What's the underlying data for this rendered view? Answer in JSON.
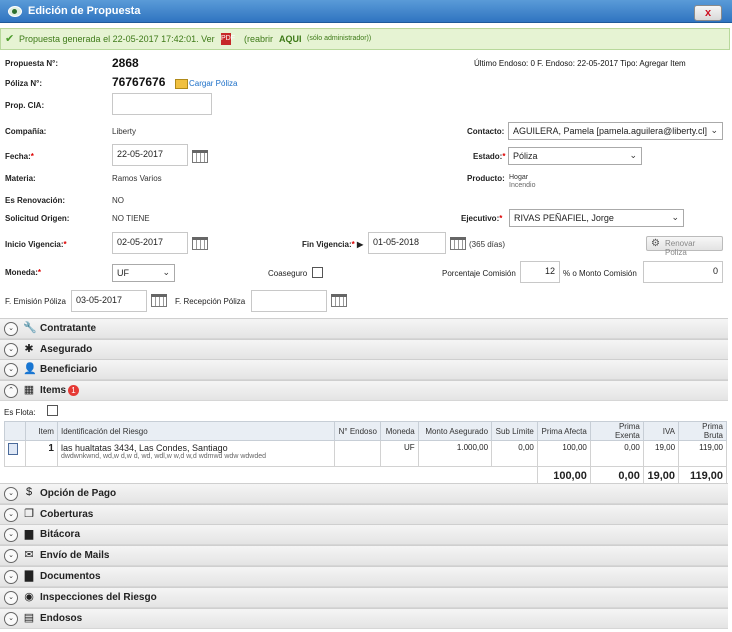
{
  "window": {
    "title": "Edición de Propuesta",
    "close_label": "x"
  },
  "notice": {
    "text": "Propuesta generada el 22-05-2017 17:42:01. Ver",
    "reopen_prefix": "(reabrir",
    "reopen_link": "AQUI",
    "admin_note": "(sólo administrador))"
  },
  "header": {
    "propuesta_label": "Propuesta N°:",
    "propuesta_value": "2868",
    "poliza_label": "Póliza N°:",
    "poliza_value": "76767676",
    "cargar_poliza": "Cargar Póliza",
    "ultimo_endoso": "Último Endoso: 0  F. Endoso: 22-05-2017  Tipo: Agregar Item"
  },
  "form": {
    "prop_cia_label": "Prop. CIA:",
    "prop_cia_value": "",
    "compania_label": "Compañía:",
    "compania_value": "Liberty",
    "contacto_label": "Contacto:",
    "contacto_value": "AGUILERA, Pamela [pamela.aguilera@liberty.cl]",
    "fecha_label": "Fecha:",
    "fecha_value": "22-05-2017",
    "estado_label": "Estado:",
    "estado_value": "Póliza",
    "materia_label": "Materia:",
    "materia_value": "Ramos Varios",
    "producto_label": "Producto:",
    "producto_value": "Hogar",
    "producto_sub": "Incendio",
    "renovacion_label": "Es Renovación:",
    "renovacion_value": "NO",
    "solicitud_label": "Solicitud Origen:",
    "solicitud_value": "NO TIENE",
    "ejecutivo_label": "Ejecutivo:",
    "ejecutivo_value": "RIVAS PEÑAFIEL, Jorge",
    "inicio_label": "Inicio Vigencia:",
    "inicio_value": "02-05-2017",
    "fin_label": "Fin Vigencia:",
    "fin_value": "01-05-2018",
    "dias": "(365 días)",
    "renovar_button": "Renovar Poliza",
    "moneda_label": "Moneda:",
    "moneda_value": "UF",
    "coaseguro_label": "Coaseguro",
    "porcentaje_label": "Porcentaje Comisión",
    "porcentaje_value": "12",
    "monto_label": "% o Monto Comisión",
    "monto_value": "0",
    "f_emision_label": "F. Emisión Póliza",
    "f_emision_value": "03-05-2017",
    "f_recepcion_label": "F. Recepción Póliza",
    "f_recepcion_value": ""
  },
  "sections_top": [
    {
      "name": "Contratante",
      "icon": "wrench-icon",
      "glyph": "🔧"
    },
    {
      "name": "Asegurado",
      "icon": "gear-icon",
      "glyph": "✱"
    },
    {
      "name": "Beneficiario",
      "icon": "user-icon",
      "glyph": "👤"
    }
  ],
  "items_section": {
    "name": "Items",
    "badge": "1",
    "es_flota_label": "Es Flota:"
  },
  "items_table": {
    "headers": [
      "",
      "Item",
      "Identificación del Riesgo",
      "N° Endoso",
      "Moneda",
      "Monto Asegurado",
      "Sub Límite",
      "Prima Afecta",
      "Prima Exenta",
      "IVA",
      "Prima Bruta"
    ],
    "rows": [
      {
        "item": "1",
        "riesgo": "las hualtatas 3434, Las Condes, Santiago",
        "riesgo_sub": "dwdwnkwnd, wd,w d,w d, wd, wdl,w w,d w,d wdmwd wdw wdwded",
        "endoso": "",
        "moneda": "UF",
        "monto": "1.000,00",
        "sub_limite": "0,00",
        "prima_afecta": "100,00",
        "prima_exenta": "0,00",
        "iva": "19,00",
        "prima_bruta": "119,00"
      }
    ],
    "totals": {
      "prima_afecta": "100,00",
      "prima_exenta": "0,00",
      "iva": "19,00",
      "prima_bruta": "119,00"
    }
  },
  "sections_bottom": [
    {
      "name": "Opción de Pago",
      "icon": "dollar-icon",
      "glyph": "$"
    },
    {
      "name": "Coberturas",
      "icon": "copy-icon",
      "glyph": "❐"
    },
    {
      "name": "Bitácora",
      "icon": "book-icon",
      "glyph": "▆"
    },
    {
      "name": "Envío de Mails",
      "icon": "mail-icon",
      "glyph": "✉"
    },
    {
      "name": "Documentos",
      "icon": "briefcase-icon",
      "glyph": "▇"
    },
    {
      "name": "Inspecciones del Riesgo",
      "icon": "eye-icon",
      "glyph": "◉"
    },
    {
      "name": "Endosos",
      "icon": "file-icon",
      "glyph": "▤"
    }
  ]
}
